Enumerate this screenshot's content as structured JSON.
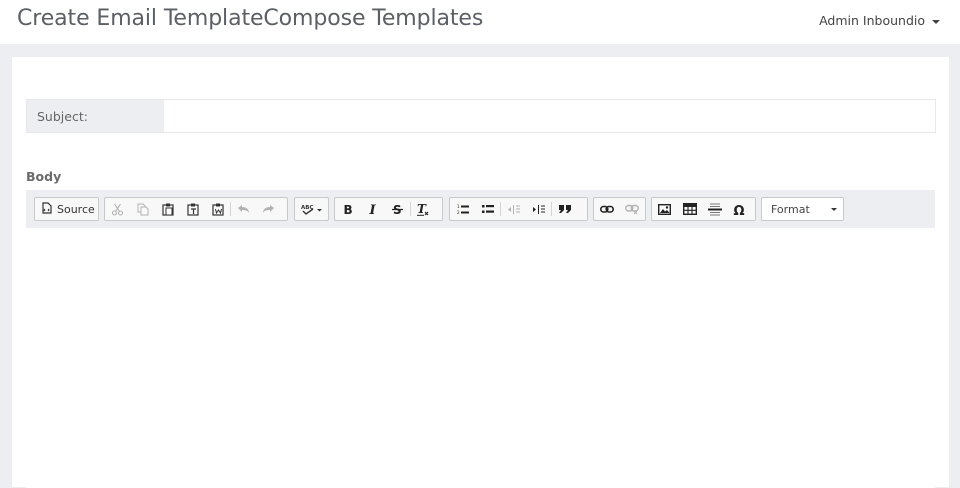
{
  "header": {
    "title": "Create Email TemplateCompose Templates",
    "user_name": "Admin Inboundio"
  },
  "form": {
    "subject_label": "Subject:",
    "subject_value": "",
    "body_label": "Body"
  },
  "toolbar": {
    "source_label": "Source",
    "format_label": "Format",
    "icons": [
      "source-icon",
      "cut-icon",
      "copy-icon",
      "paste-icon",
      "paste-text-icon",
      "paste-word-icon",
      "undo-icon",
      "redo-icon",
      "spellcheck-icon",
      "bold-icon",
      "italic-icon",
      "strike-icon",
      "remove-format-icon",
      "numbered-list-icon",
      "bulleted-list-icon",
      "outdent-icon",
      "indent-icon",
      "blockquote-icon",
      "link-icon",
      "unlink-icon",
      "image-icon",
      "table-icon",
      "horizontal-rule-icon",
      "special-char-icon"
    ]
  }
}
